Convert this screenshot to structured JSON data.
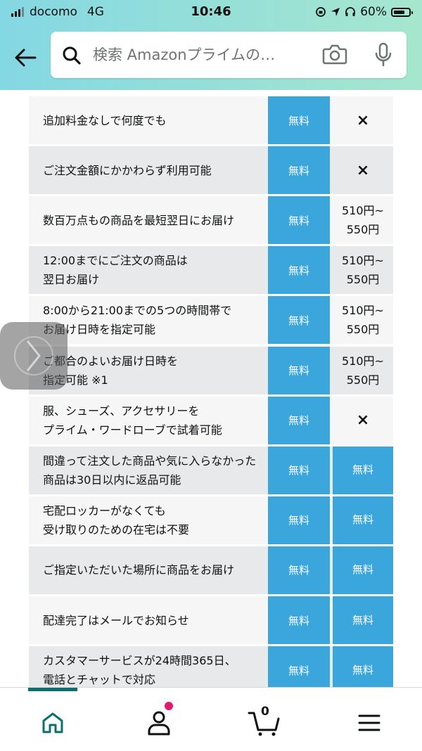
{
  "status": {
    "carrier": "docomo",
    "network": "4G",
    "time": "10:46",
    "battery": "60%"
  },
  "search": {
    "placeholder": "検索 Amazonプライムの…"
  },
  "colors": {
    "header_gradient_start": "#84d8e3",
    "header_gradient_end": "#a6e6ce",
    "free_cell": "#3aa6db",
    "row_alt": "#e7e9ea",
    "row_light": "#f6f6f6",
    "nav_indicator": "#0e6e6e",
    "notification_dot": "#e3186f"
  },
  "icons": {
    "back": "arrow-left-icon",
    "search": "magnifier-icon",
    "camera": "camera-icon",
    "mic": "microphone-icon",
    "home": "home-icon",
    "account": "person-icon",
    "cart": "cart-icon",
    "menu": "hamburger-icon",
    "swipe": "chevron-right-icon"
  },
  "table": {
    "rows": [
      {
        "label": "追加料金なしで何度でも",
        "prime": "無料",
        "other": "×",
        "other_free": false,
        "shade": "light"
      },
      {
        "label": "ご注文金額にかかわらず利用可能",
        "prime": "無料",
        "other": "×",
        "other_free": false,
        "shade": "dark"
      },
      {
        "label": "数百万点もの商品を最短翌日にお届け",
        "prime": "無料",
        "other": "510円~\n550円",
        "other_free": false,
        "shade": "light"
      },
      {
        "label": "12:00までにご注文の商品は\n翌日お届け",
        "prime": "無料",
        "other": "510円~\n550円",
        "other_free": false,
        "shade": "dark"
      },
      {
        "label": "8:00から21:00までの5つの時間帯で\nお届け日時を指定可能",
        "prime": "無料",
        "other": "510円~\n550円",
        "other_free": false,
        "shade": "light"
      },
      {
        "label": "ご都合のよいお届け日時を\n指定可能 ※1",
        "prime": "無料",
        "other": "510円~\n550円",
        "other_free": false,
        "shade": "dark"
      },
      {
        "label": "服、シューズ、アクセサリーを\nプライム・ワードローブで試着可能",
        "prime": "無料",
        "other": "×",
        "other_free": false,
        "shade": "light"
      },
      {
        "label": "間違って注文した商品や気に入らなかった\n商品は30日以内に返品可能",
        "prime": "無料",
        "other": "無料",
        "other_free": true,
        "shade": "dark"
      },
      {
        "label": "宅配ロッカーがなくても\n受け取りのための在宅は不要",
        "prime": "無料",
        "other": "無料",
        "other_free": true,
        "shade": "light"
      },
      {
        "label": "ご指定いただいた場所に商品をお届け",
        "prime": "無料",
        "other": "無料",
        "other_free": true,
        "shade": "dark"
      },
      {
        "label": "配達完了はメールでお知らせ",
        "prime": "無料",
        "other": "無料",
        "other_free": true,
        "shade": "light"
      },
      {
        "label": "カスタマーサービスが24時間365日、\n電話とチャットで対応",
        "prime": "無料",
        "other": "無料",
        "other_free": true,
        "shade": "dark"
      }
    ]
  },
  "nav": {
    "cart_count": "0"
  }
}
